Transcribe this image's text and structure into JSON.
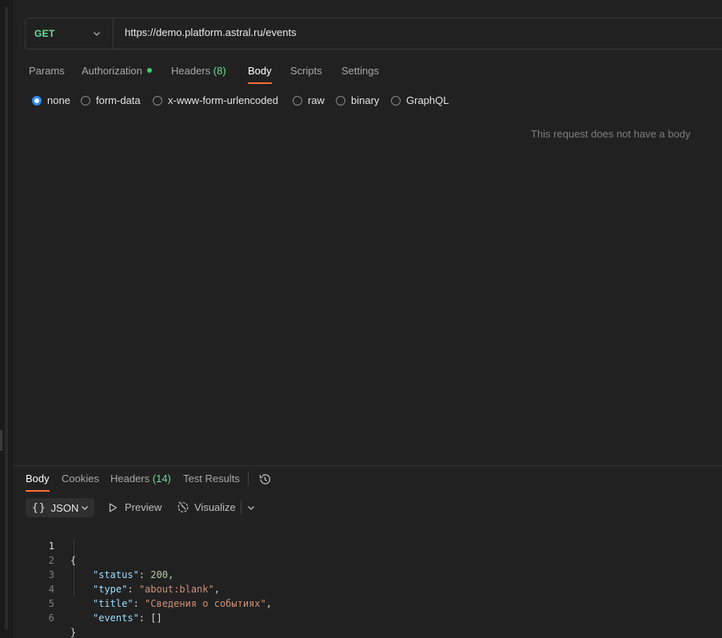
{
  "request": {
    "method": "GET",
    "url": "https://demo.platform.astral.ru/events"
  },
  "request_tabs": {
    "params": "Params",
    "authorization": "Authorization",
    "headers": "Headers",
    "headers_count": "(8)",
    "body": "Body",
    "scripts": "Scripts",
    "settings": "Settings"
  },
  "body_types": {
    "none": "none",
    "form_data": "form-data",
    "urlencoded": "x-www-form-urlencoded",
    "raw": "raw",
    "binary": "binary",
    "graphql": "GraphQL",
    "selected": "none"
  },
  "no_body_message": "This request does not have a body",
  "response_tabs": {
    "body": "Body",
    "cookies": "Cookies",
    "headers": "Headers",
    "headers_count": "(14)",
    "test_results": "Test Results"
  },
  "format": {
    "braces": "{}",
    "selected": "JSON",
    "preview": "Preview",
    "visualize": "Visualize"
  },
  "response_code": {
    "line_numbers": [
      "1",
      "2",
      "3",
      "4",
      "5",
      "6"
    ],
    "open_brace": "{",
    "close_brace": "}",
    "fields": [
      {
        "key": "\"status\"",
        "value": "200",
        "sep": ",",
        "kind": "number"
      },
      {
        "key": "\"type\"",
        "value": "\"about:blank\"",
        "sep": ",",
        "kind": "string"
      },
      {
        "key": "\"title\"",
        "value": "\"Сведения о событиях\"",
        "sep": ",",
        "kind": "string"
      },
      {
        "key": "\"events\"",
        "value": "[]",
        "sep": "",
        "kind": "plain"
      }
    ]
  },
  "colors": {
    "method_get": "#6bdd9a",
    "accent_underline": "#ff6c37",
    "radio_selected": "#2f8cf0",
    "auth_dot": "#3ecf6f",
    "json_key": "#9cdcfe",
    "json_string": "#ce9178",
    "json_number": "#b5cea8"
  },
  "icons": {
    "method_dropdown": "chevron-down-icon",
    "history": "history-icon",
    "preview": "play-icon",
    "visualize": "visualize-icon",
    "format_dropdown": "chevron-down-icon"
  }
}
